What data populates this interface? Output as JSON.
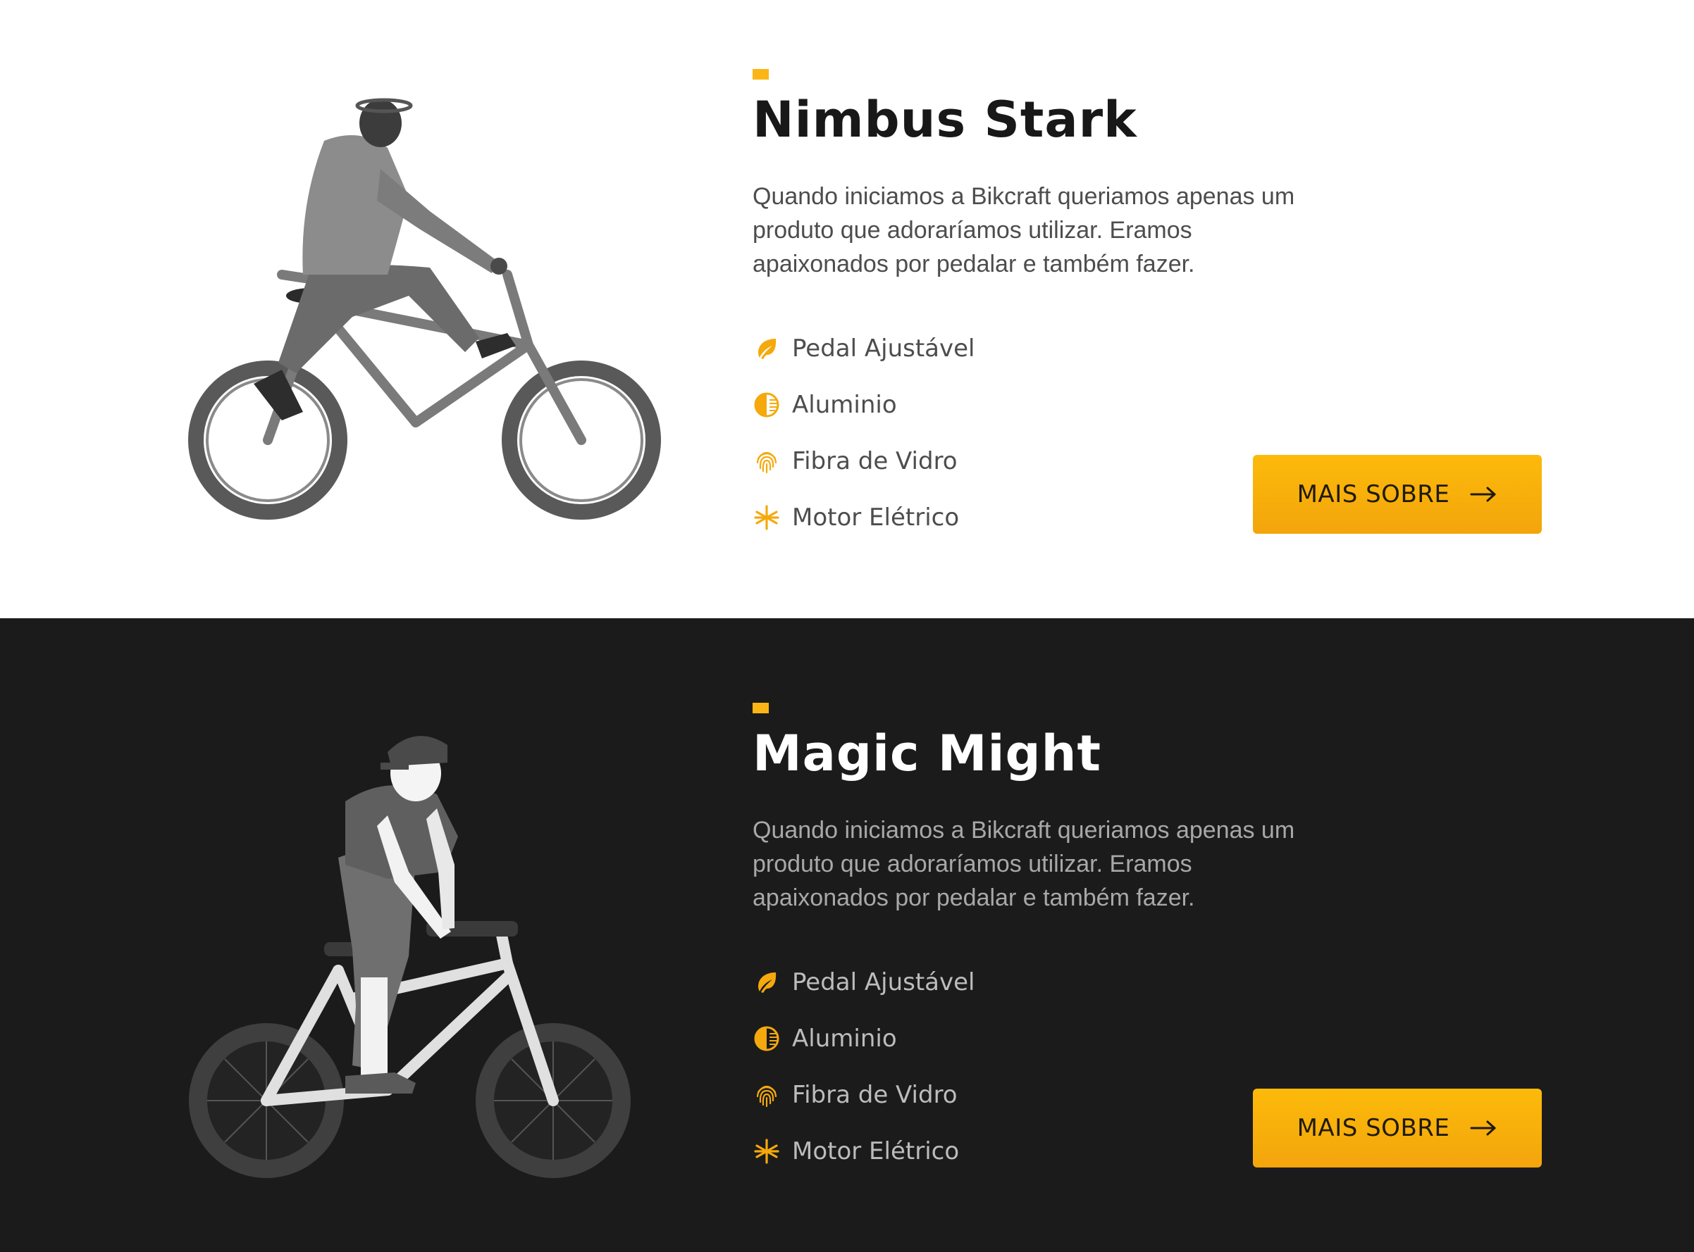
{
  "colors": {
    "accent": "#fbb615",
    "light_bg": "#ffffff",
    "dark_bg": "#1b1b1b",
    "button_text": "#1f1a0c"
  },
  "products": [
    {
      "name": "Nimbus Stark",
      "theme": "light",
      "description": "Quando iniciamos a Bikcraft queriamos apenas um produto que adoraríamos utilizar. Eramos apaixonados por pedalar e também fazer.",
      "features": [
        {
          "icon": "leaf-icon",
          "label": "Pedal Ajustável"
        },
        {
          "icon": "half-circle-icon",
          "label": "Aluminio"
        },
        {
          "icon": "fingerprint-icon",
          "label": "Fibra de Vidro"
        },
        {
          "icon": "snowflake-icon",
          "label": "Motor Elétrico"
        }
      ],
      "button_label": "MAIS SOBRE"
    },
    {
      "name": "Magic Might",
      "theme": "dark",
      "description": "Quando iniciamos a Bikcraft queriamos apenas um produto que adoraríamos utilizar. Eramos apaixonados por pedalar e também fazer.",
      "features": [
        {
          "icon": "leaf-icon",
          "label": "Pedal Ajustável"
        },
        {
          "icon": "half-circle-icon",
          "label": "Aluminio"
        },
        {
          "icon": "fingerprint-icon",
          "label": "Fibra de Vidro"
        },
        {
          "icon": "snowflake-icon",
          "label": "Motor Elétrico"
        }
      ],
      "button_label": "MAIS SOBRE"
    }
  ]
}
